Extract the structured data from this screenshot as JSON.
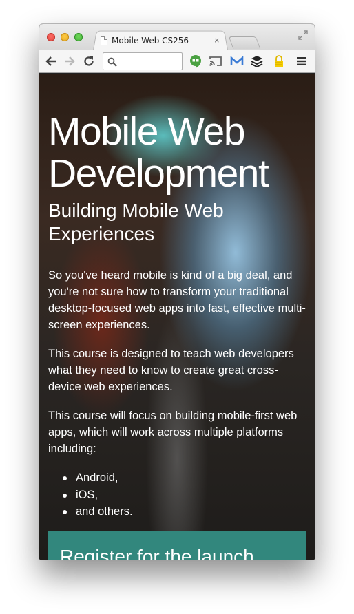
{
  "browser": {
    "tab_title": "Mobile Web CS256",
    "tab_close": "×",
    "omnibox_placeholder": "",
    "icons": {
      "back": "back-arrow-icon",
      "forward": "forward-arrow-icon",
      "reload": "reload-icon",
      "hangouts": "hangouts-icon",
      "cast": "cast-icon",
      "gmail": "gmail-icon",
      "buffer": "buffer-icon",
      "lastpass": "lock-icon",
      "menu": "hamburger-menu-icon",
      "fullscreen": "fullscreen-icon"
    }
  },
  "page": {
    "title": "Mobile Web Development",
    "subtitle": "Building Mobile Web Experiences",
    "paragraphs": [
      "So you've heard mobile is kind of a big deal, and you're not sure how to transform your traditional desktop-focused web apps into fast, effective multi-screen experiences.",
      "This course is designed to teach web developers what they need to know to create great cross-device web experiences.",
      "This course will focus on building mobile-first web apps, which will work across multiple platforms including:"
    ],
    "platforms": [
      "Android,",
      "iOS,",
      "and others."
    ],
    "register_title": "Register for the launch"
  },
  "colors": {
    "register_bg": "#32877d",
    "text": "#ffffff"
  }
}
